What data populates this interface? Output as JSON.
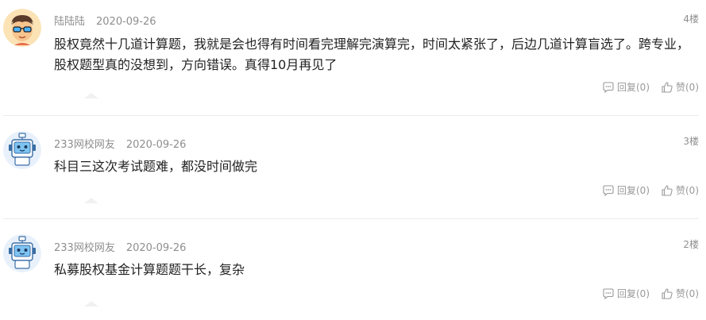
{
  "comments": [
    {
      "user": "陆陆陆",
      "date": "2020-09-26",
      "floor": "4楼",
      "text": "股权竟然十几道计算题，我就是会也得有时间看完理解完演算完，时间太紧张了，后边几道计算盲选了。跨专业，股权题型真的没想到，方向错误。真得10月再见了",
      "reply": "回复(0)",
      "like": "赞(0)",
      "avatar": "avatar-with-sunglasses-icon"
    },
    {
      "user": "233网校网友",
      "date": "2020-09-26",
      "floor": "3楼",
      "text": "科目三这次考试题难，都没时间做完",
      "reply": "回复(0)",
      "like": "赞(0)",
      "avatar": "robot-avatar-icon"
    },
    {
      "user": "233网校网友",
      "date": "2020-09-26",
      "floor": "2楼",
      "text": "私募股权基金计算题题干长，复杂",
      "reply": "回复(0)",
      "like": "赞(0)",
      "avatar": "robot-avatar-icon"
    }
  ],
  "colors": {
    "meta": "#8e8e8e",
    "text": "#222222",
    "divider": "#ececec"
  }
}
